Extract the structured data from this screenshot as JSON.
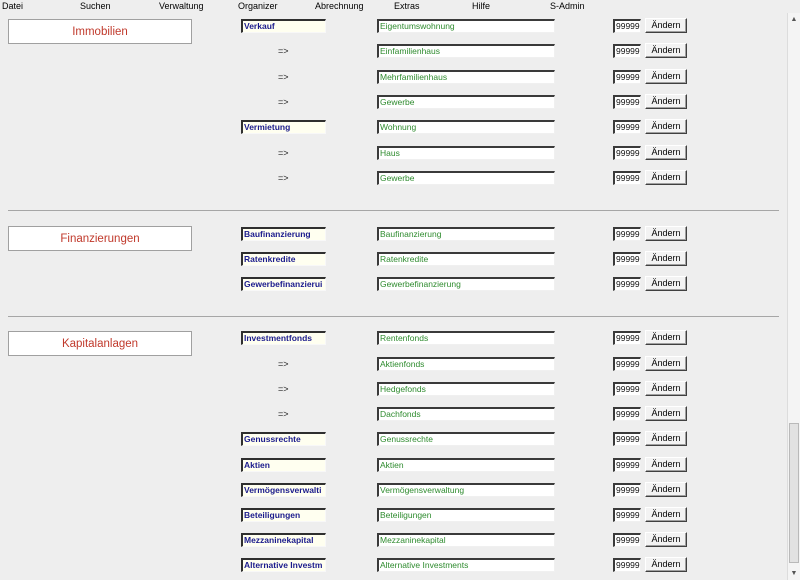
{
  "menu": [
    "Datei",
    "Suchen",
    "Verwaltung",
    "Organizer",
    "Abrechnung",
    "Extras",
    "Hilfe",
    "S-Admin"
  ],
  "sections": [
    {
      "title": "Immobilien",
      "rows": [
        {
          "category": "Verkauf",
          "sub": "Eigentumswohnung",
          "num": "99999"
        },
        {
          "arrow": "=>",
          "sub": "Einfamilienhaus",
          "num": "99999"
        },
        {
          "arrow": "=>",
          "sub": "Mehrfamilienhaus",
          "num": "99999"
        },
        {
          "arrow": "=>",
          "sub": "Gewerbe",
          "num": "99999"
        },
        {
          "category": "Vermietung",
          "sub": "Wohnung",
          "num": "99999"
        },
        {
          "arrow": "=>",
          "sub": "Haus",
          "num": "99999"
        },
        {
          "arrow": "=>",
          "sub": "Gewerbe",
          "num": "99999"
        }
      ]
    },
    {
      "title": "Finanzierungen",
      "rows": [
        {
          "category": "Baufinanzierung",
          "sub": "Baufinanzierung",
          "num": "99999"
        },
        {
          "category": "Ratenkredite",
          "sub": "Ratenkredite",
          "num": "99999"
        },
        {
          "category": "Gewerbefinanzierui",
          "sub": "Gewerbefinanzierung",
          "num": "99999"
        }
      ]
    },
    {
      "title": "Kapitalanlagen",
      "rows": [
        {
          "category": "Investmentfonds",
          "sub": "Rentenfonds",
          "num": "99999"
        },
        {
          "arrow": "=>",
          "sub": "Aktienfonds",
          "num": "99999"
        },
        {
          "arrow": "=>",
          "sub": "Hedgefonds",
          "num": "99999"
        },
        {
          "arrow": "=>",
          "sub": "Dachfonds",
          "num": "99999"
        },
        {
          "category": "Genussrechte",
          "sub": "Genussrechte",
          "num": "99999"
        },
        {
          "category": "Aktien",
          "sub": "Aktien",
          "num": "99999"
        },
        {
          "category": "Vermögensverwalti",
          "sub": "Vermögensverwaltung",
          "num": "99999"
        },
        {
          "category": "Beteiligungen",
          "sub": "Beteiligungen",
          "num": "99999"
        },
        {
          "category": "Mezzaninekapital",
          "sub": "Mezzaninekapital",
          "num": "99999"
        },
        {
          "category": "Alternative Investm",
          "sub": "Alternative Investments",
          "num": "99999"
        }
      ]
    }
  ],
  "button_label": "Ändern"
}
